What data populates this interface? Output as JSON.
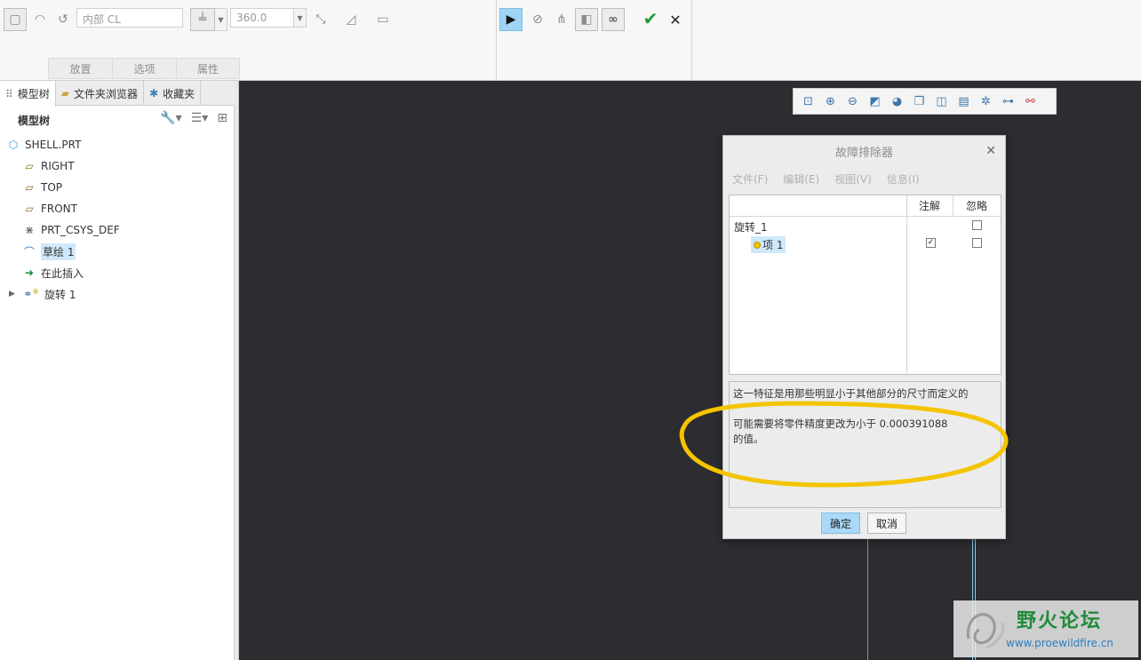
{
  "ribbon": {
    "reference_input": "内部 CL",
    "angle_input": "360.0",
    "tabs": [
      "放置",
      "选项",
      "属性"
    ]
  },
  "panel": {
    "tabs": [
      {
        "label": "模型树",
        "icon": "model-tree-icon"
      },
      {
        "label": "文件夹浏览器",
        "icon": "folder-icon"
      },
      {
        "label": "收藏夹",
        "icon": "favorites-icon"
      }
    ],
    "tree_title": "模型树",
    "tree": [
      {
        "label": "SHELL.PRT",
        "icon": "part-icon",
        "color": "#3c9ad8"
      },
      {
        "label": "RIGHT",
        "icon": "datum-plane-icon",
        "color": "#8a6b1f"
      },
      {
        "label": "TOP",
        "icon": "datum-plane-icon",
        "color": "#8a6b1f"
      },
      {
        "label": "FRONT",
        "icon": "datum-plane-icon",
        "color": "#8a6b1f"
      },
      {
        "label": "PRT_CSYS_DEF",
        "icon": "csys-icon",
        "color": "#555555"
      },
      {
        "label": "草绘 1",
        "icon": "sketch-icon",
        "color": "#3c7fb8"
      },
      {
        "label": "在此插入",
        "icon": "insert-here-icon",
        "color": "#1f8b3a"
      },
      {
        "label": "旋转 1",
        "icon": "revolve-icon",
        "color": "#3c7fb8"
      }
    ]
  },
  "dialog": {
    "title": "故障排除器",
    "menu": [
      "文件(F)",
      "编辑(E)",
      "视图(V)",
      "信息(I)"
    ],
    "col_note": "注解",
    "col_ignore": "忽略",
    "row_feature": "旋转_1",
    "row_item": "项 1",
    "row_item_note_checked": true,
    "message_line1": "这一特征是用那些明显小于其他部分的尺寸而定义的",
    "message_line2": "可能需要将零件精度更改为小于 0.000391088",
    "message_line3": "的值。",
    "ok_label": "确定",
    "cancel_label": "取消"
  },
  "watermark": {
    "title": "野火论坛",
    "url": "www.proewildfire.cn"
  },
  "colors": {
    "accent": "#9fd4f3",
    "annotation": "#f5c400",
    "confirm_green": "#1f9a3a"
  }
}
